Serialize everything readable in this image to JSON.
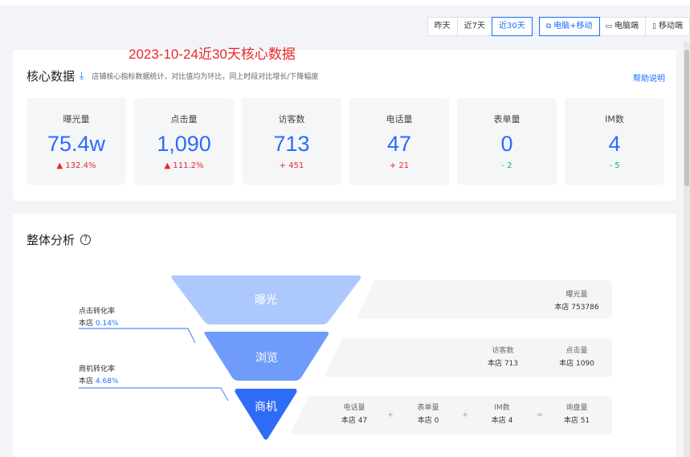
{
  "toolbar": {
    "date_range": [
      "昨天",
      "近7天",
      "近30天"
    ],
    "device": [
      "电脑+移动",
      "电脑端",
      "移动端"
    ]
  },
  "overlay_title": "2023-10-24近30天核心数据",
  "core": {
    "title": "核心数据",
    "desc": "店铺核心指标数据统计，对比值均为环比，同上时段对比增长/下降幅度",
    "help": "帮助说明",
    "metrics": [
      {
        "label": "曝光量",
        "value": "75.4w",
        "change": "132.4%",
        "dir": "up"
      },
      {
        "label": "点击量",
        "value": "1,090",
        "change": "111.2%",
        "dir": "up"
      },
      {
        "label": "访客数",
        "value": "713",
        "change": "+ 451",
        "dir": "up"
      },
      {
        "label": "电话量",
        "value": "47",
        "change": "+ 21",
        "dir": "up"
      },
      {
        "label": "表单量",
        "value": "0",
        "change": "- 2",
        "dir": "down"
      },
      {
        "label": "IM数",
        "value": "4",
        "change": "- 5",
        "dir": "down"
      }
    ]
  },
  "analysis": {
    "title": "整体分析",
    "funnel": {
      "stage1": "曝光",
      "stage2": "浏览",
      "stage3": "商机"
    },
    "click_rate": {
      "label": "点击转化率",
      "prefix": "本店",
      "value": "0.14%"
    },
    "biz_rate": {
      "label": "商机转化率",
      "prefix": "本店",
      "value": "4.68%"
    },
    "row1": [
      {
        "label": "曝光量",
        "value": "本店 753786"
      }
    ],
    "row2": [
      {
        "label": "访客数",
        "value": "本店 713"
      },
      {
        "label": "点击量",
        "value": "本店 1090"
      }
    ],
    "row3": [
      {
        "label": "电话量",
        "value": "本店 47"
      },
      {
        "label": "表单量",
        "value": "本店 0"
      },
      {
        "label": "IM数",
        "value": "本店 4"
      },
      {
        "label": "询盘量",
        "value": "本店 51"
      }
    ],
    "ops": [
      "+",
      "+",
      "="
    ]
  }
}
